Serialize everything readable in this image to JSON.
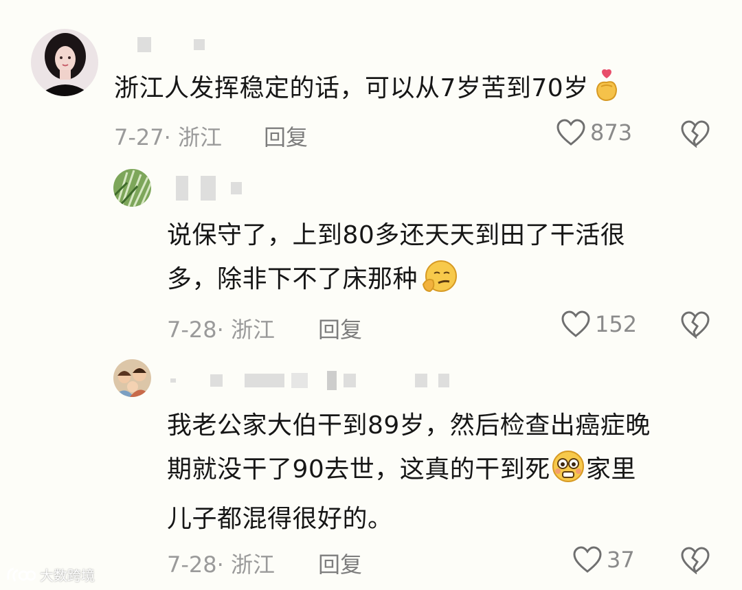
{
  "comments": [
    {
      "text": "浙江人发挥稳定的话，可以从7岁苦到70岁",
      "emoji": "finger-heart",
      "date_location": "7-27· 浙江",
      "reply_label": "回复",
      "likes": "873"
    },
    {
      "text_line1": "说保守了，上到80多还天天到田了干活很",
      "text_line2": "多，除非下不了床那种",
      "emoji": "thinking-smug-face",
      "date_location": "7-28· 浙江",
      "reply_label": "回复",
      "likes": "152"
    },
    {
      "text_line1": "我老公家大伯干到89岁，然后检查出癌症晚",
      "text_line2a": "期就没干了90去世，这真的干到死",
      "text_line2b": "家里",
      "text_line3": "儿子都混得很好的。",
      "emoji": "flushed-face",
      "date_location": "7-28· 浙江",
      "reply_label": "回复",
      "likes": "37"
    }
  ],
  "watermark": {
    "text": "大数跨境"
  },
  "colors": {
    "background": "#fdfdf8",
    "meta_text": "#9a9a9a",
    "body_text": "#161616"
  }
}
